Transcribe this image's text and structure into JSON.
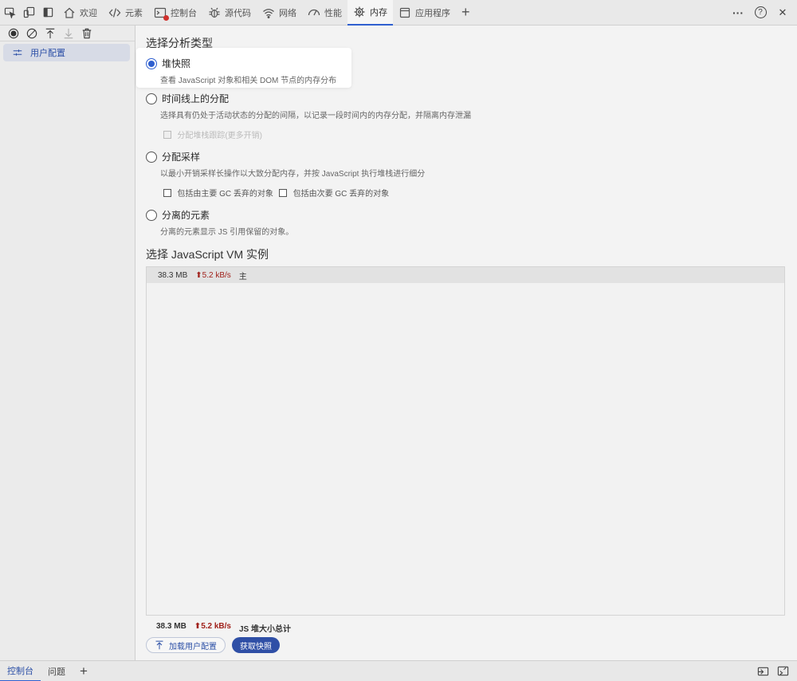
{
  "toolbar": {
    "tabs": [
      {
        "label": "欢迎",
        "icon": "home-icon"
      },
      {
        "label": "元素",
        "icon": "code-icon"
      },
      {
        "label": "控制台",
        "icon": "console-icon"
      },
      {
        "label": "源代码",
        "icon": "bug-icon"
      },
      {
        "label": "网络",
        "icon": "wifi-icon"
      },
      {
        "label": "性能",
        "icon": "gauge-icon"
      },
      {
        "label": "内存",
        "icon": "chip-icon"
      },
      {
        "label": "应用程序",
        "icon": "app-icon"
      }
    ],
    "more_label": "···",
    "help_label": "?",
    "close_label": "✕",
    "add_label": "+"
  },
  "sidebar": {
    "profile_label": "用户配置"
  },
  "main": {
    "analysis_title": "选择分析类型",
    "options": [
      {
        "label": "堆快照",
        "desc": "查看 JavaScript 对象和相关 DOM 节点的内存分布",
        "selected": true
      },
      {
        "label": "时间线上的分配",
        "desc": "选择具有仍处于活动状态的分配的间隔，以记录一段时间内的内存分配，并隔离内存泄漏",
        "checkbox": "分配堆栈跟踪(更多开销)"
      },
      {
        "label": "分配采样",
        "desc": "以最小开销采样长操作以大致分配内存，并按 JavaScript 执行堆栈进行细分",
        "checkbox_a": "包括由主要 GC 丢弃的对象",
        "checkbox_b": "包括由次要 GC 丢弃的对象"
      },
      {
        "label": "分离的元素",
        "desc": "分离的元素显示 JS 引用保留的对象。"
      }
    ],
    "vm_title": "选择 JavaScript VM 实例",
    "vm_row": {
      "size": "38.3 MB",
      "rate": "5.2 kB/s",
      "name": "主"
    },
    "summary": {
      "size": "38.3 MB",
      "rate": "5.2 kB/s",
      "label": "JS 堆大小总计"
    },
    "load_button": "加载用户配置",
    "snapshot_button": "获取快照"
  },
  "drawer": {
    "tabs": [
      "控制台",
      "问题"
    ],
    "add_label": "+"
  },
  "colors": {
    "accent": "#2f5fcf",
    "rate": "#a0211b"
  }
}
